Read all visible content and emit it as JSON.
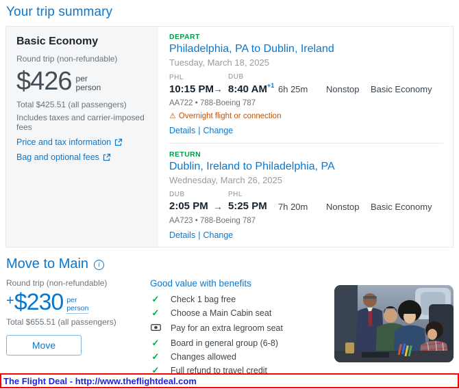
{
  "page": {
    "title": "Your trip summary"
  },
  "icons": {
    "arrow": "→",
    "warning": "⚠",
    "check": "✓",
    "info": "i",
    "separator": "|"
  },
  "colors": {
    "brand_blue": "#0977ce",
    "success_green": "#009a49",
    "warning_orange": "#c25205",
    "dark_text": "#16222e",
    "gray_text": "#6a737b",
    "footer_border_red": "#fe0000",
    "footer_link_blue": "#2121de"
  },
  "trip_card": {
    "fare": {
      "name": "Basic Economy",
      "trip_type": "Round trip (non-refundable)",
      "price": "$426",
      "per": "per",
      "person": "person",
      "total": "Total $425.51 (all passengers)",
      "includes": "Includes taxes and carrier-imposed fees",
      "link_price": "Price and tax information",
      "link_bag": "Bag and optional fees"
    },
    "slices": [
      {
        "direction": "DEPART",
        "route": "Philadelphia, PA to Dublin, Ireland",
        "date": "Tuesday, March 18, 2025",
        "origin_code": "PHL",
        "dest_code": "DUB",
        "depart_time": "10:15 PM",
        "arrive_time": "8:40 AM",
        "arrive_day_offset": "+1",
        "duration": "6h 25m",
        "stops": "Nonstop",
        "cabin": "Basic Economy",
        "flight_info": "AA722 • 788-Boeing 787",
        "warning": "Overnight flight or connection",
        "details_label": "Details",
        "change_label": "Change"
      },
      {
        "direction": "RETURN",
        "route": "Dublin, Ireland to Philadelphia, PA",
        "date": "Wednesday, March 26, 2025",
        "origin_code": "DUB",
        "dest_code": "PHL",
        "depart_time": "2:05 PM",
        "arrive_time": "5:25 PM",
        "duration": "7h 20m",
        "stops": "Nonstop",
        "cabin": "Basic Economy",
        "flight_info": "AA723 • 788-Boeing 787",
        "details_label": "Details",
        "change_label": "Change"
      }
    ]
  },
  "move_to_main": {
    "title": "Move to Main",
    "trip_type": "Round trip (non-refundable)",
    "plus": "+",
    "price": "$230",
    "per": "per",
    "person": "person",
    "total": "Total $655.51 (all passengers)",
    "move_button": "Move",
    "benefits_title": "Good value with benefits",
    "benefits": [
      {
        "icon": "check-icon",
        "label": "Check 1 bag free"
      },
      {
        "icon": "check-icon",
        "label": "Choose a Main Cabin seat"
      },
      {
        "icon": "cash-icon",
        "label": "Pay for an extra legroom seat"
      },
      {
        "icon": "check-icon",
        "label": "Board in general group (6-8)"
      },
      {
        "icon": "check-icon",
        "label": "Changes allowed"
      },
      {
        "icon": "check-icon",
        "label": "Full refund to travel credit"
      }
    ]
  },
  "footer": {
    "text": "The Flight Deal - http://www.theflightdeal.com"
  }
}
